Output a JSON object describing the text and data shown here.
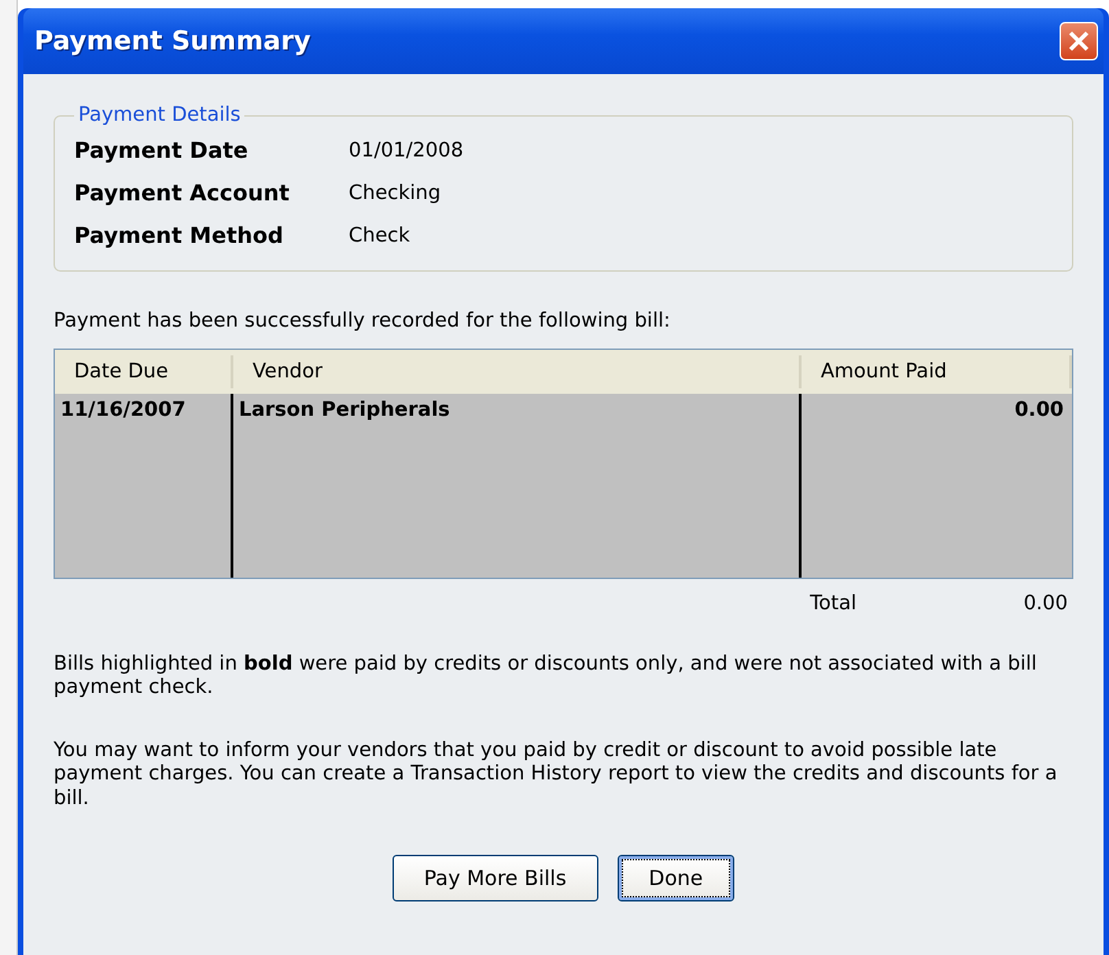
{
  "window": {
    "title": "Payment Summary"
  },
  "payment_details": {
    "legend": "Payment Details",
    "fields": [
      {
        "label": "Payment Date",
        "value": "01/01/2008"
      },
      {
        "label": "Payment Account",
        "value": "Checking"
      },
      {
        "label": "Payment Method",
        "value": "Check"
      }
    ]
  },
  "intro": "Payment has been successfully recorded for the following bill:",
  "table": {
    "columns": [
      "Date Due",
      "Vendor",
      "Amount Paid"
    ],
    "rows": [
      {
        "cells": [
          "11/16/2007",
          "Larson Peripherals",
          "0.00"
        ],
        "bold": true
      }
    ],
    "total_label": "Total",
    "total_value": "0.00"
  },
  "notes": [
    "Bills highlighted in **bold** were paid by credits or discounts only, and were not associated with a bill payment check.",
    "You may want to inform your vendors that you paid by credit or discount to avoid possible late payment charges. You can create a Transaction History report to view the credits and discounts for a bill."
  ],
  "buttons": [
    {
      "label": "Pay More Bills",
      "focused": false
    },
    {
      "label": "Done",
      "focused": true
    }
  ]
}
